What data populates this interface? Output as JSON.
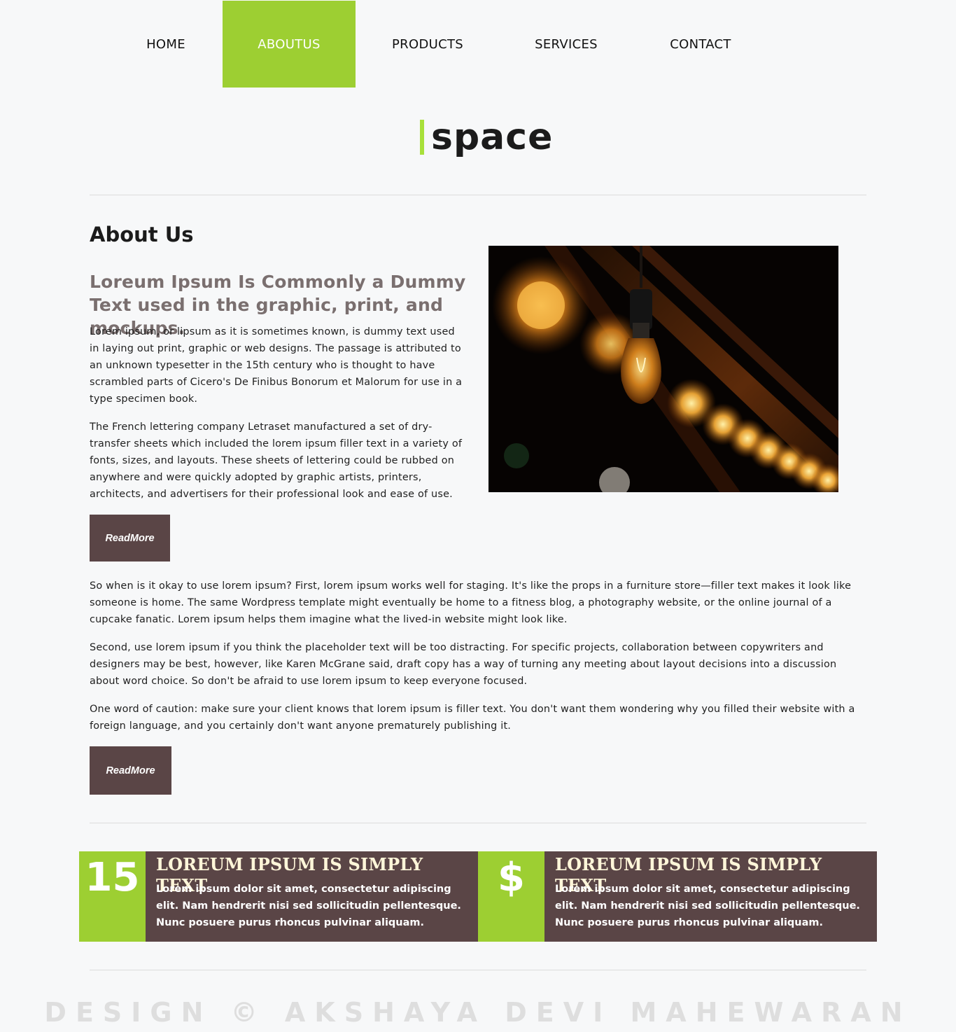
{
  "nav": {
    "items": [
      {
        "label": "HOME"
      },
      {
        "label": "ABOUTUS"
      },
      {
        "label": "PRODUCTS"
      },
      {
        "label": "SERVICES"
      },
      {
        "label": "CONTACT"
      }
    ],
    "active": "ABOUTUS"
  },
  "logo": {
    "text": "space"
  },
  "about": {
    "heading": "About Us",
    "subheading": "Loreum Ipsum Is Commonly a Dummy Text used in the graphic, print, and mockups.",
    "para1": "Lorem ipsum, or lipsum as it is sometimes known, is dummy text used in laying out print, graphic or web designs. The passage is attributed to an unknown typesetter in the 15th century who is thought to have scrambled parts of Cicero's De Finibus Bonorum et Malorum for use in a type specimen book.",
    "para2": "The French lettering company Letraset manufactured a set of dry-transfer sheets which included the lorem ipsum filler text in a variety of fonts, sizes, and layouts. These sheets of lettering could be rubbed on anywhere and were quickly adopted by graphic artists, printers, architects, and advertisers for their professional look and ease of use.",
    "button1": "ReadMore",
    "para3": "So when is it okay to use lorem ipsum? First, lorem ipsum works well for staging. It's like the props in a furniture store—filler text makes it look like someone is home. The same Wordpress template might eventually be home to a fitness blog, a photography website, or the online journal of a cupcake fanatic. Lorem ipsum helps them imagine what the lived-in website might look like.",
    "para4": "Second, use lorem ipsum if you think the placeholder text will be too distracting. For specific projects, collaboration between copywriters and designers may be best, however, like Karen McGrane said, draft copy has a way of turning any meeting about layout decisions into a discussion about word choice. So don't be afraid to use lorem ipsum to keep everyone focused.",
    "para5": "One word of caution: make sure your client knows that lorem ipsum is filler text. You don't want them wondering why you filled their website with a foreign language, and you certainly don't want anyone prematurely publishing it.",
    "button2": "ReadMore"
  },
  "features": [
    {
      "badge": "15",
      "title": "LOREUM IPSUM IS SIMPLY TEXT",
      "text": "Lorem ipsum dolor sit amet, consectetur adipiscing elit. Nam hendrerit nisi sed sollicitudin pellentesque. Nunc posuere purus rhoncus pulvinar aliquam."
    },
    {
      "badge": "$",
      "title": "LOREUM IPSUM IS SIMPLY TEXT",
      "text": "Lorem ipsum dolor sit amet, consectetur adipiscing elit. Nam hendrerit nisi sed sollicitudin pellentesque. Nunc posuere purus rhoncus pulvinar aliquam."
    }
  ],
  "footer": {
    "text": "DESIGN © AKSHAYA DEVI MAHEWARAN"
  },
  "colors": {
    "accent": "#9dcf32",
    "dark": "#5a4546",
    "logo_bar": "#a8e03a",
    "background": "#f7f8f9"
  }
}
